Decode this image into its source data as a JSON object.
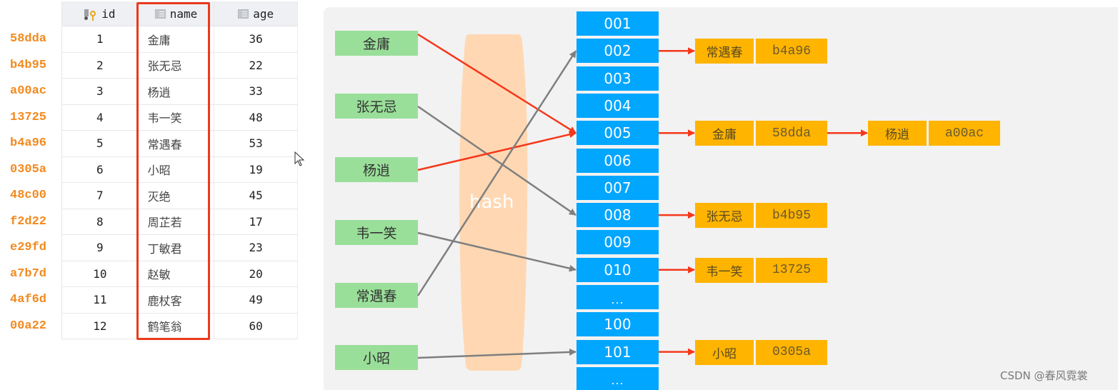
{
  "table": {
    "columns": [
      {
        "label": "id",
        "icon": "primary-key-column-icon"
      },
      {
        "label": "name",
        "icon": "table-column-icon"
      },
      {
        "label": "age",
        "icon": "table-column-icon"
      }
    ],
    "rows": [
      {
        "hash": "58dda",
        "id": "1",
        "name": "金庸",
        "age": "36"
      },
      {
        "hash": "b4b95",
        "id": "2",
        "name": "张无忌",
        "age": "22"
      },
      {
        "hash": "a00ac",
        "id": "3",
        "name": "杨逍",
        "age": "33"
      },
      {
        "hash": "13725",
        "id": "4",
        "name": "韦一笑",
        "age": "48"
      },
      {
        "hash": "b4a96",
        "id": "5",
        "name": "常遇春",
        "age": "53"
      },
      {
        "hash": "0305a",
        "id": "6",
        "name": "小昭",
        "age": "19"
      },
      {
        "hash": "48c00",
        "id": "7",
        "name": "灭绝",
        "age": "45"
      },
      {
        "hash": "f2d22",
        "id": "8",
        "name": "周芷若",
        "age": "17"
      },
      {
        "hash": "e29fd",
        "id": "9",
        "name": "丁敏君",
        "age": "23"
      },
      {
        "hash": "a7b7d",
        "id": "10",
        "name": "赵敏",
        "age": "20"
      },
      {
        "hash": "4af6d",
        "id": "11",
        "name": "鹿杖客",
        "age": "49"
      },
      {
        "hash": "00a22",
        "id": "12",
        "name": "鹤笔翁",
        "age": "60"
      }
    ],
    "highlighted_column": "name"
  },
  "diagram": {
    "hash_label": "hash",
    "keys": [
      "金庸",
      "张无忌",
      "杨逍",
      "韦一笑",
      "常遇春",
      "小昭"
    ],
    "buckets": [
      "001",
      "002",
      "003",
      "004",
      "005",
      "006",
      "007",
      "008",
      "009",
      "010",
      "...",
      "100",
      "101",
      "..."
    ],
    "mappings": [
      {
        "key": "金庸",
        "bucket": "005",
        "highlight": true
      },
      {
        "key": "张无忌",
        "bucket": "008",
        "highlight": false
      },
      {
        "key": "杨逍",
        "bucket": "005",
        "highlight": true
      },
      {
        "key": "韦一笑",
        "bucket": "010",
        "highlight": false
      },
      {
        "key": "常遇春",
        "bucket": "002",
        "highlight": false
      },
      {
        "key": "小昭",
        "bucket": "101",
        "highlight": false
      }
    ],
    "chains": [
      {
        "bucket": "002",
        "entries": [
          {
            "name": "常遇春",
            "hash": "b4a96"
          }
        ]
      },
      {
        "bucket": "005",
        "entries": [
          {
            "name": "金庸",
            "hash": "58dda"
          },
          {
            "name": "杨逍",
            "hash": "a00ac"
          }
        ]
      },
      {
        "bucket": "008",
        "entries": [
          {
            "name": "张无忌",
            "hash": "b4b95"
          }
        ]
      },
      {
        "bucket": "010",
        "entries": [
          {
            "name": "韦一笑",
            "hash": "13725"
          }
        ]
      },
      {
        "bucket": "101",
        "entries": [
          {
            "name": "小昭",
            "hash": "0305a"
          }
        ]
      }
    ],
    "colors": {
      "key_box": "#99df99",
      "bucket": "#01a6ff",
      "entry": "#ffb400",
      "highlight_arrow": "#f5381b",
      "normal_arrow": "#7f7f7f",
      "hash_funnel": "#ffd8b3",
      "hash_text_color": "#f28a1f"
    }
  },
  "watermark": "CSDN @春风霓裳"
}
